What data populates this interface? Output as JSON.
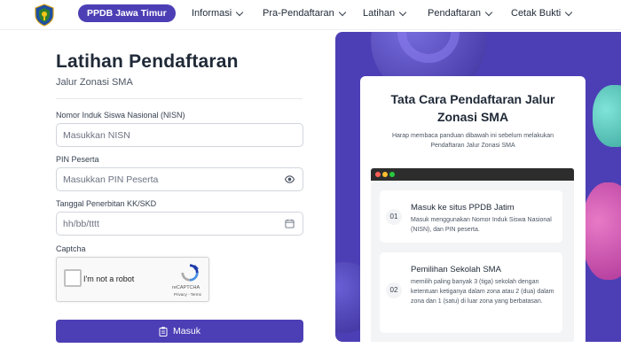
{
  "navbar": {
    "brand": "PPDB Jawa Timur",
    "menu": [
      {
        "label": "Informasi"
      },
      {
        "label": "Pra-Pendaftaran"
      },
      {
        "label": "Latihan"
      },
      {
        "label": "Pendaftaran"
      },
      {
        "label": "Cetak Bukti"
      }
    ]
  },
  "form": {
    "title": "Latihan Pendaftaran",
    "subtitle": "Jalur Zonasi SMA",
    "nisn": {
      "label": "Nomor Induk Siswa Nasional (NISN)",
      "placeholder": "Masukkan NISN",
      "value": ""
    },
    "pin": {
      "label": "PIN Peserta",
      "placeholder": "Masukkan PIN Peserta",
      "value": "",
      "icon": "eye-icon"
    },
    "date": {
      "label": "Tanggal Penerbitan KK/SKD",
      "placeholder": "hh/bb/tttt",
      "value": "",
      "icon": "calendar-icon"
    },
    "captcha": {
      "label": "Captcha",
      "checkbox_label": "I'm not a robot",
      "brand": "reCAPTCHA",
      "links": "Privacy - Terms"
    },
    "submit": {
      "label": "Masuk",
      "icon": "clipboard-icon"
    }
  },
  "panel": {
    "title": "Tata Cara Pendaftaran Jalur Zonasi SMA",
    "description": "Harap membaca panduan dibawah ini sebelum melakukan Pendaftaran Jalur Zonasi SMA",
    "steps": [
      {
        "number": "01",
        "title": "Masuk ke situs PPDB Jatim",
        "description": "Masuk menggunakan Nomor Induk Siswa Nasional (NISN), dan PIN peserta."
      },
      {
        "number": "02",
        "title": "Pemilihan Sekolah SMA",
        "description": "memilih paling banyak 3 (tiga) sekolah dengan ketentuan ketiganya dalam zona atau 2 (dua) dalam zona dan 1 (satu) di luar zona yang berbatasan."
      }
    ]
  },
  "colors": {
    "primary": "#4c3fb5",
    "background": "#ffffff"
  }
}
